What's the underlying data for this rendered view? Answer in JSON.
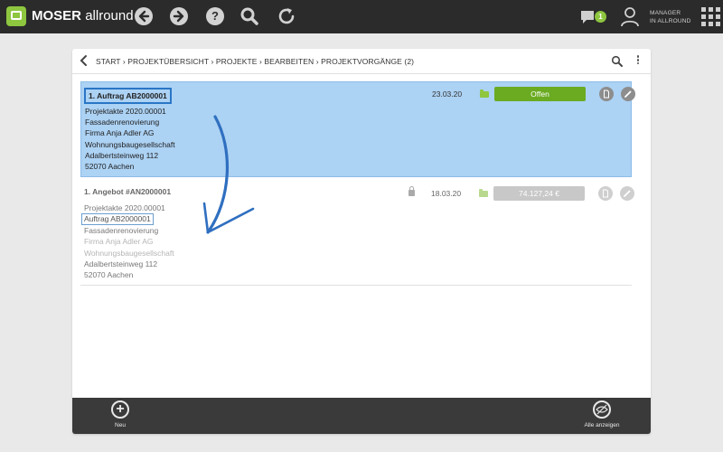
{
  "app": {
    "brand_bold": "MOSER",
    "brand_light": "allround",
    "user_label_line1": "MANAGER",
    "user_label_line2": "IN ALLROUND",
    "chat_badge": "1"
  },
  "toolbar": {
    "back_glyph": "‹",
    "forward_glyph": "›",
    "help_glyph": "?"
  },
  "breadcrumb": {
    "text": "START › PROJEKTÜBERSICHT › PROJEKTE › BEARBEITEN › PROJEKTVORGÄNGE  (2)"
  },
  "entries": [
    {
      "title": "1. Auftrag AB2000001",
      "lines": [
        "Projektakte 2020.00001",
        "Fassadenrenovierung",
        "Firma Anja Adler AG",
        "Wohnungsbaugesellschaft",
        "Adalbertsteinweg 112",
        "52070 Aachen"
      ],
      "date": "23.03.20",
      "status": "Offen",
      "selected": true
    },
    {
      "title": "1. Angebot #AN2000001",
      "lines": [
        "Projektakte 2020.00001",
        "Auftrag AB2000001",
        "Fassadenrenovierung",
        "Firma Anja Adler AG",
        "Wohnungsbaugesellschaft",
        "Adalbertsteinweg 112",
        "52070 Aachen"
      ],
      "date": "18.03.20",
      "status": "74.127,24 €",
      "locked": true
    }
  ],
  "bottom": {
    "new_label": "Neu",
    "show_all_label": "Alle anzeigen"
  },
  "colors": {
    "accent_green": "#8ec63f",
    "status_green": "#6aab22",
    "selection_blue": "#acd2f4",
    "highlight_border": "#2a76c6"
  }
}
